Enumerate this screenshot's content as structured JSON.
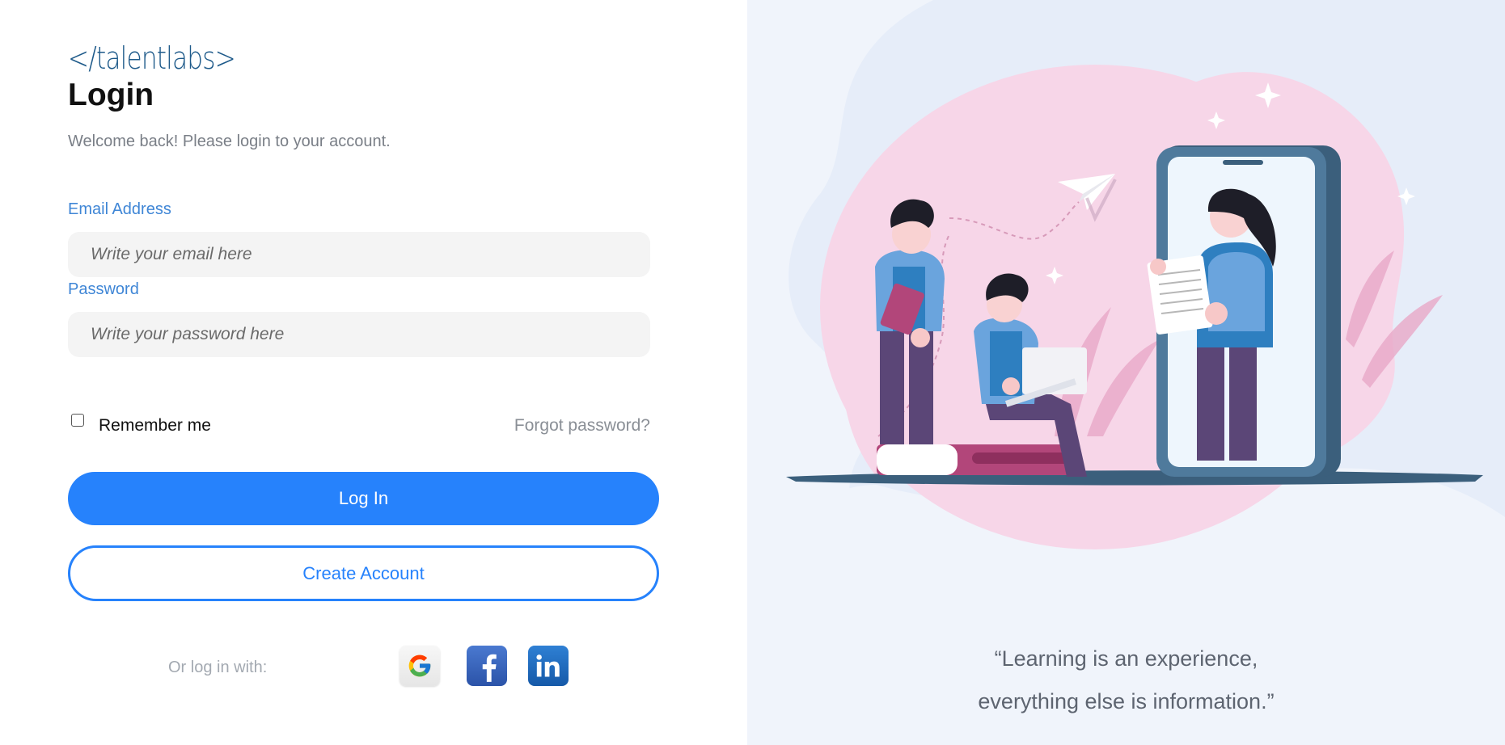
{
  "brand": {
    "logo_text": "</talentlabs>"
  },
  "header": {
    "title": "Login",
    "subtitle": "Welcome back! Please login to your account."
  },
  "form": {
    "email_label": "Email Address",
    "email_placeholder": "Write your email here",
    "password_label": "Password",
    "password_placeholder": "Write your password here",
    "remember_label": "Remember me",
    "remember_checked": false,
    "forgot_label": "Forgot password?",
    "login_label": "Log In",
    "create_label": "Create Account"
  },
  "social": {
    "label": "Or log in with:",
    "providers": [
      {
        "name": "Google",
        "icon": "google-icon"
      },
      {
        "name": "Facebook",
        "icon": "facebook-icon"
      },
      {
        "name": "LinkedIn",
        "icon": "linkedin-icon"
      }
    ]
  },
  "quote": {
    "line1": "“Learning is an experience,",
    "line2": "everything else is information.”"
  },
  "colors": {
    "accent": "#2682fc",
    "label": "#3f86d6",
    "panel_bg": "#f0f4fb",
    "blob_pink": "#f7d6e8"
  }
}
